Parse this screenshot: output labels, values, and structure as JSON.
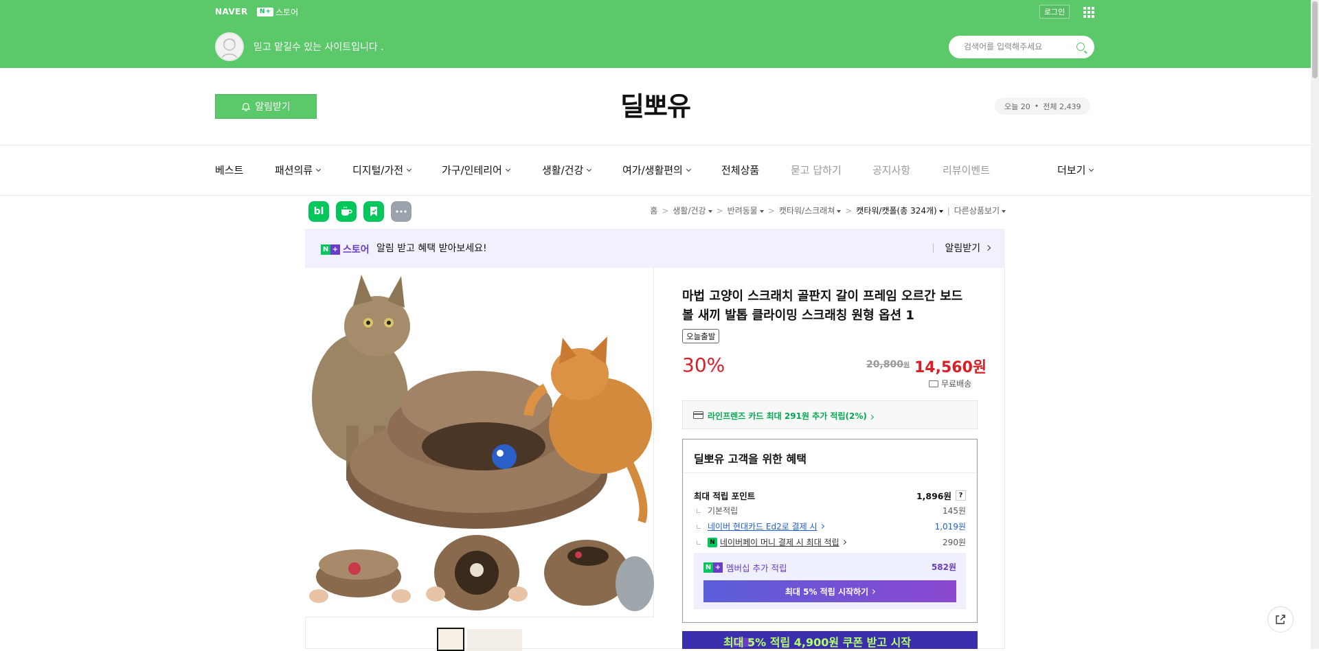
{
  "topbar": {
    "naver": "NAVER",
    "store_logo": "스토어",
    "login": "로그인",
    "tagline": "믿고 맡길수 있는 사이트입니다 .",
    "search_placeholder": "검색어를 입력해주세요"
  },
  "store": {
    "alarm_button": "알림받기",
    "name": "딜뽀유",
    "visit_today": "오늘 20",
    "visit_total": "전체 2,439"
  },
  "nav": {
    "items": [
      {
        "label": "베스트"
      },
      {
        "label": "패션의류"
      },
      {
        "label": "디지털/가전"
      },
      {
        "label": "가구/인테리어"
      },
      {
        "label": "생활/건강"
      },
      {
        "label": "여가/생활편의"
      },
      {
        "label": "전체상품"
      },
      {
        "label": "묻고 답하기"
      },
      {
        "label": "공지사항"
      },
      {
        "label": "리뷰이벤트"
      },
      {
        "label": "더보기"
      }
    ]
  },
  "share": {
    "blog": "bl"
  },
  "breadcrumb": {
    "home": "홈",
    "c1": "생활/건강",
    "c2": "반려동물",
    "c3": "캣타워/스크래쳐",
    "c4": "캣타워/캣폴(총 324개)",
    "other": "다른상품보기"
  },
  "promo": {
    "logo": "스토어",
    "text": "알림 받고 혜택 받아보세요!",
    "action": "알림받기"
  },
  "product": {
    "title": "마법 고양이 스크래치 골판지 갈이 프레임 오르간 보드 볼 새끼 발톱 클라이밍 스크래칭 원형 옵션 1",
    "badge": "오늘출발",
    "discount": "30%",
    "original_price": "20,800",
    "original_unit": "원",
    "price": "14,560원",
    "shipping": "무료배송",
    "card_benefit": "라인프렌즈 카드 최대 291원 추가 적립(2%)"
  },
  "benefit": {
    "title": "딜뽀유 고객을 위한 혜택",
    "max_label": "최대 적립 포인트",
    "max_value": "1,896원",
    "q": "?",
    "rows": [
      {
        "label": "기본적립",
        "value": "145원"
      },
      {
        "label": "네이버 현대카드 Ed2로 결제 시",
        "value": "1,019원"
      },
      {
        "label": "네이버페이 머니 결제 시 최대 적립",
        "value": "290원"
      }
    ],
    "npay": "N",
    "member_label": "멤버십 추가 적립",
    "member_value": "582원",
    "member_button": "최대 5% 적립 시작하기"
  },
  "banner": {
    "text": "최대 5% 적립 4,900원 쿠폰 받고 시작"
  },
  "colors": {
    "brand_green": "#5bc86a",
    "naver_green": "#03c75a",
    "price_red": "#d81e26",
    "membership_purple": "#6a3cc9"
  }
}
